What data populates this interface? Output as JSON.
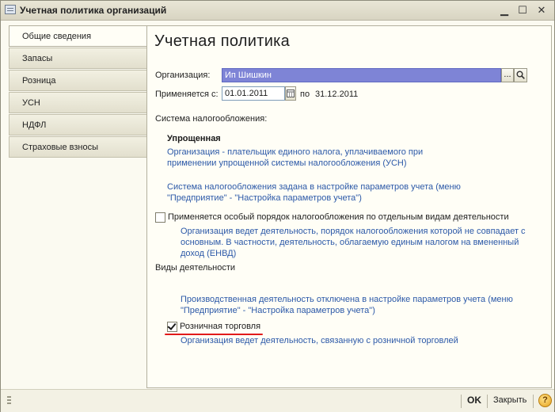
{
  "window": {
    "title": "Учетная политика организаций"
  },
  "tabs": [
    {
      "label": "Общие сведения",
      "active": true
    },
    {
      "label": "Запасы"
    },
    {
      "label": "Розница"
    },
    {
      "label": "УСН"
    },
    {
      "label": "НДФЛ"
    },
    {
      "label": "Страховые взносы"
    }
  ],
  "main": {
    "heading": "Учетная политика",
    "org_label": "Организация:",
    "org_value": "Ип Шишкин",
    "org_select_btn": "...",
    "applies_label": "Применяется с:",
    "applies_date": "01.01.2011",
    "applies_to_label": "по",
    "applies_to_date": "31.12.2011",
    "tax_system_label": "Система налогообложения:",
    "tax_system_name": "Упрощенная",
    "tax_system_desc": "Организация - плательщик единого налога, уплачиваемого при применении упрощенной системы налогообложения (УСН)",
    "tax_system_note": "Система налогообложения задана в настройке параметров учета (меню \"Предприятие\" - \"Настройка параметров учета\")",
    "special_order_label": "Применяется особый порядок налогообложения по отдельным видам деятельности",
    "special_order_desc": "Организация ведет деятельность, порядок налогообложения которой не совпадает с основным. В частности, деятельность, облагаемую единым налогом на вмененный доход (ЕНВД)",
    "activities_label": "Виды деятельности",
    "production_note": "Производственная деятельность отключена в настройке параметров учета (меню \"Предприятие\" - \"Настройка параметров учета\")",
    "retail_label": "Розничная торговля",
    "retail_desc": "Организация ведет деятельность, связанную с розничной торговлей"
  },
  "footer": {
    "ok": "OK",
    "close": "Закрыть",
    "help": "?"
  },
  "colors": {
    "link_blue": "#2c59a8",
    "selection": "#7e84d6",
    "annotation_red": "#e11a1a"
  }
}
